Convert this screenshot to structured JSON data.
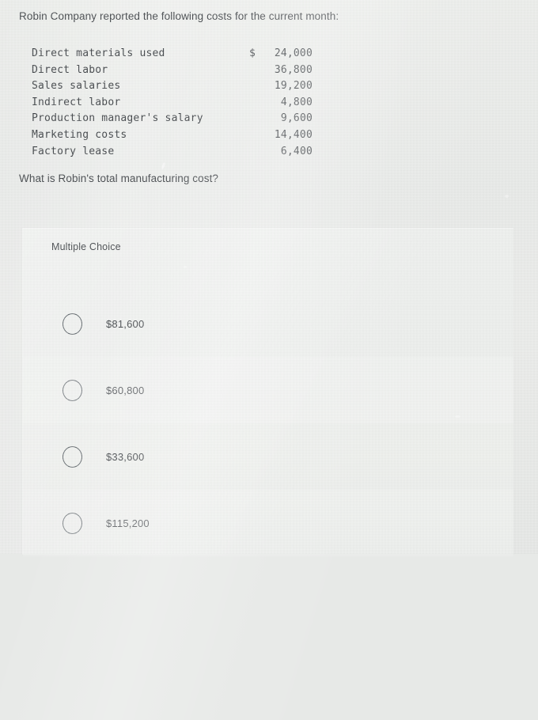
{
  "question": {
    "stem": "Robin Company reported the following costs for the current month:",
    "prompt": "What is Robin's total manufacturing cost?",
    "currency_symbol": "$"
  },
  "cost_table": {
    "rows": [
      {
        "label": "Direct materials used",
        "currency": "$",
        "amount": "24,000"
      },
      {
        "label": "Direct labor",
        "currency": "",
        "amount": "36,800"
      },
      {
        "label": "Sales salaries",
        "currency": "",
        "amount": "19,200"
      },
      {
        "label": "Indirect labor",
        "currency": "",
        "amount": "4,800"
      },
      {
        "label": "Production manager's salary",
        "currency": "",
        "amount": "9,600"
      },
      {
        "label": "Marketing costs",
        "currency": "",
        "amount": "14,400"
      },
      {
        "label": "Factory lease",
        "currency": "",
        "amount": "6,400"
      }
    ]
  },
  "answer_card": {
    "kind_label": "Multiple Choice",
    "options": [
      {
        "value": "$81,600",
        "selected": false
      },
      {
        "value": "$60,800",
        "selected": false
      },
      {
        "value": "$33,600",
        "selected": false
      },
      {
        "value": "$115,200",
        "selected": false
      }
    ]
  },
  "colors": {
    "page_background": "#e7e9e7",
    "card_background": "#eceeec",
    "text": "#3d4144",
    "radio_border": "#5c6368"
  }
}
